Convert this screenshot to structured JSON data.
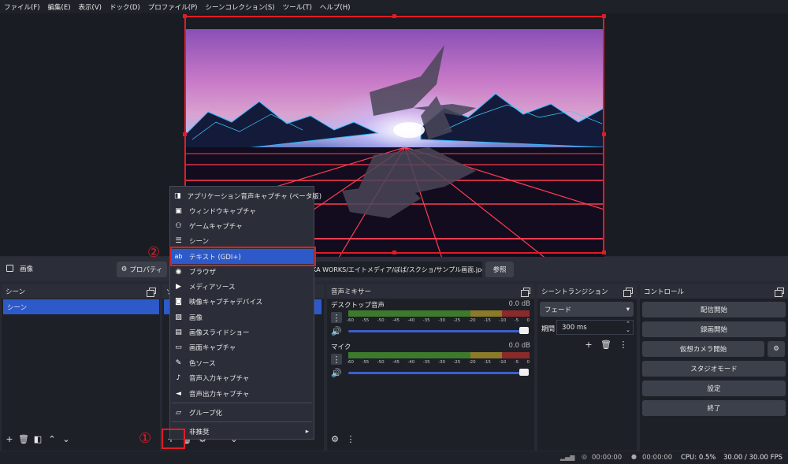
{
  "menubar": [
    "ファイル(F)",
    "編集(E)",
    "表示(V)",
    "ドック(D)",
    "プロファイル(P)",
    "シーンコレクション(S)",
    "ツール(T)",
    "ヘルプ(H)"
  ],
  "source_toolbar": {
    "source_name": "画像",
    "properties_label": "プロパティ",
    "file_path": "KA WORKS/エイトメディア/ぼば/スクショ/サンプル画面.jpeg",
    "browse_label": "参照"
  },
  "scenes": {
    "title": "シーン",
    "items": [
      "シーン"
    ]
  },
  "context_menu": {
    "items": [
      {
        "label": "アプリケーション音声キャプチャ (ベータ版)",
        "icon": "app-audio-icon"
      },
      {
        "label": "ウィンドウキャプチャ",
        "icon": "window-icon"
      },
      {
        "label": "ゲームキャプチャ",
        "icon": "gamepad-icon"
      },
      {
        "label": "シーン",
        "icon": "list-icon"
      },
      {
        "label": "テキスト (GDI+)",
        "icon": "text-icon"
      },
      {
        "label": "ブラウザ",
        "icon": "globe-icon"
      },
      {
        "label": "メディアソース",
        "icon": "play-icon"
      },
      {
        "label": "映像キャプチャデバイス",
        "icon": "camera-icon"
      },
      {
        "label": "画像",
        "icon": "image-icon"
      },
      {
        "label": "画像スライドショー",
        "icon": "slideshow-icon"
      },
      {
        "label": "画面キャプチャ",
        "icon": "monitor-icon"
      },
      {
        "label": "色ソース",
        "icon": "brush-icon"
      },
      {
        "label": "音声入力キャプチャ",
        "icon": "mic-icon"
      },
      {
        "label": "音声出力キャプチャ",
        "icon": "speaker-icon"
      }
    ],
    "group_label": "グループ化",
    "deprecated_label": "非推奨"
  },
  "annotations": {
    "one": "①",
    "two": "②"
  },
  "mixer": {
    "title": "音声ミキサー",
    "channels": [
      {
        "name": "デスクトップ音声",
        "db": "0.0 dB"
      },
      {
        "name": "マイク",
        "db": "0.0 dB"
      }
    ],
    "ticks": [
      "-60",
      "-55",
      "-50",
      "-45",
      "-40",
      "-35",
      "-30",
      "-25",
      "-20",
      "-15",
      "-10",
      "-5",
      "0"
    ]
  },
  "transitions": {
    "title": "シーントランジション",
    "selected": "フェード",
    "duration_label": "期間",
    "duration_value": "300 ms"
  },
  "controls": {
    "title": "コントロール",
    "start_stream": "配信開始",
    "start_record": "録画開始",
    "virtual_cam": "仮想カメラ開始",
    "studio_mode": "スタジオモード",
    "settings": "設定",
    "exit": "終了"
  },
  "status": {
    "stream_time": "00:00:00",
    "record_time": "00:00:00",
    "cpu": "CPU: 0.5%",
    "fps": "30.00 / 30.00 FPS"
  },
  "colors": {
    "accent": "#2d5ac8",
    "annotation_red": "#e01c24",
    "background": "#272a33"
  }
}
